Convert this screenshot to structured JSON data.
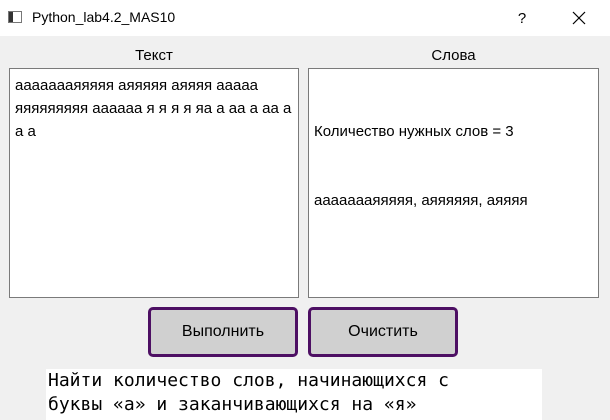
{
  "window": {
    "title": "Python_lab4.2_MAS10",
    "help_label": "?"
  },
  "labels": {
    "text": "Текст",
    "words": "Слова"
  },
  "text_input": {
    "value": "аааааааяяяяя аяяяяя аяяяя ааааа яяяяяяяяя аааааа я я я я яа а аа а аа а а а"
  },
  "words_output": {
    "line1": "Количество нужных слов = 3",
    "line2": "аааааааяяяяя, аяяяяяя, аяяяя"
  },
  "buttons": {
    "run": "Выполнить",
    "clear": "Очистить"
  },
  "task": {
    "line1": "Найти количество слов, начинающихся с",
    "line2": "буквы «а» и заканчивающихся на «я»"
  },
  "colors": {
    "button_border": "#4d0f63",
    "button_bg": "#d0d0d0",
    "window_bg": "#f0f0f0"
  }
}
